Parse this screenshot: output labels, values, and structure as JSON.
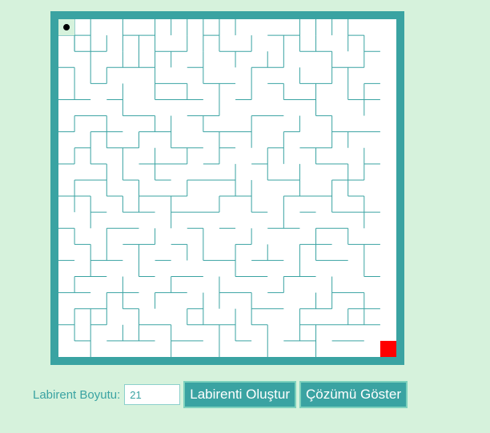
{
  "maze": {
    "size": 21,
    "colors": {
      "border": "#3aa3a2",
      "wall": "#3aa3a2",
      "background": "#ffffff",
      "page": "#d6f2dc",
      "goal": "#ff0000",
      "player": "#000000",
      "start_cell": "#d6f2dc"
    },
    "start": {
      "row": 0,
      "col": 0
    },
    "goal": {
      "row": 20,
      "col": 20
    },
    "walls": [
      [
        1,
        0,
        1,
        2
      ],
      [
        2,
        0,
        2,
        2
      ],
      [
        4,
        0,
        4,
        2
      ],
      [
        6,
        0,
        6,
        2
      ],
      [
        7,
        0,
        7,
        1
      ],
      [
        8,
        0,
        8,
        1
      ],
      [
        9,
        0,
        9,
        2
      ],
      [
        10,
        0,
        10,
        1
      ],
      [
        11,
        0,
        11,
        1
      ],
      [
        15,
        0,
        15,
        2
      ],
      [
        16,
        0,
        16,
        1
      ],
      [
        17,
        0,
        17,
        1
      ],
      [
        18,
        0,
        18,
        2
      ],
      [
        1,
        1,
        1,
        2
      ],
      [
        3,
        1,
        3,
        2
      ],
      [
        5,
        1,
        5,
        3
      ],
      [
        8,
        1,
        8,
        2
      ],
      [
        10,
        1,
        10,
        2
      ],
      [
        12,
        1,
        12,
        2
      ],
      [
        14,
        1,
        14,
        3
      ],
      [
        16,
        1,
        16,
        2
      ],
      [
        19,
        1,
        19,
        3
      ],
      [
        2,
        2,
        2,
        4
      ],
      [
        4,
        2,
        4,
        3
      ],
      [
        6,
        2,
        6,
        3
      ],
      [
        7,
        2,
        7,
        3
      ],
      [
        9,
        2,
        9,
        3
      ],
      [
        11,
        2,
        11,
        3
      ],
      [
        13,
        2,
        13,
        3
      ],
      [
        17,
        2,
        17,
        4
      ],
      [
        1,
        3,
        1,
        5
      ],
      [
        3,
        3,
        3,
        4
      ],
      [
        6,
        3,
        6,
        5
      ],
      [
        9,
        3,
        9,
        4
      ],
      [
        12,
        3,
        12,
        5
      ],
      [
        15,
        3,
        15,
        4
      ],
      [
        18,
        3,
        18,
        5
      ],
      [
        4,
        4,
        4,
        6
      ],
      [
        8,
        4,
        8,
        5
      ],
      [
        10,
        4,
        10,
        6
      ],
      [
        14,
        4,
        14,
        5
      ],
      [
        16,
        4,
        16,
        6
      ],
      [
        19,
        4,
        19,
        6
      ],
      [
        1,
        6,
        1,
        7
      ],
      [
        3,
        6,
        3,
        8
      ],
      [
        6,
        6,
        6,
        7
      ],
      [
        7,
        6,
        7,
        8
      ],
      [
        9,
        6,
        9,
        7
      ],
      [
        12,
        6,
        12,
        8
      ],
      [
        15,
        6,
        15,
        7
      ],
      [
        17,
        6,
        17,
        8
      ],
      [
        2,
        7,
        2,
        9
      ],
      [
        5,
        7,
        5,
        8
      ],
      [
        10,
        7,
        10,
        9
      ],
      [
        14,
        7,
        14,
        9
      ],
      [
        18,
        7,
        18,
        8
      ],
      [
        1,
        8,
        1,
        9
      ],
      [
        4,
        8,
        4,
        10
      ],
      [
        6,
        8,
        6,
        10
      ],
      [
        8,
        8,
        8,
        9
      ],
      [
        13,
        8,
        13,
        10
      ],
      [
        16,
        8,
        16,
        9
      ],
      [
        19,
        8,
        19,
        10
      ],
      [
        3,
        9,
        3,
        11
      ],
      [
        11,
        9,
        11,
        11
      ],
      [
        15,
        9,
        15,
        11
      ],
      [
        18,
        9,
        18,
        11
      ],
      [
        1,
        10,
        1,
        12
      ],
      [
        5,
        10,
        5,
        12
      ],
      [
        8,
        10,
        8,
        11
      ],
      [
        12,
        10,
        12,
        12
      ],
      [
        17,
        10,
        17,
        12
      ],
      [
        2,
        11,
        2,
        13
      ],
      [
        4,
        11,
        4,
        12
      ],
      [
        7,
        11,
        7,
        13
      ],
      [
        10,
        11,
        10,
        12
      ],
      [
        14,
        11,
        14,
        13
      ],
      [
        19,
        11,
        19,
        13
      ],
      [
        1,
        13,
        1,
        14
      ],
      [
        3,
        13,
        3,
        15
      ],
      [
        6,
        13,
        6,
        14
      ],
      [
        9,
        13,
        9,
        15
      ],
      [
        12,
        13,
        12,
        14
      ],
      [
        16,
        13,
        16,
        15
      ],
      [
        18,
        13,
        18,
        14
      ],
      [
        2,
        14,
        2,
        16
      ],
      [
        5,
        14,
        5,
        16
      ],
      [
        8,
        14,
        8,
        15
      ],
      [
        11,
        14,
        11,
        16
      ],
      [
        13,
        14,
        13,
        15
      ],
      [
        15,
        14,
        15,
        16
      ],
      [
        19,
        14,
        19,
        16
      ],
      [
        1,
        16,
        1,
        17
      ],
      [
        4,
        16,
        4,
        18
      ],
      [
        7,
        16,
        7,
        17
      ],
      [
        10,
        16,
        10,
        18
      ],
      [
        14,
        16,
        14,
        17
      ],
      [
        17,
        16,
        17,
        18
      ],
      [
        3,
        17,
        3,
        19
      ],
      [
        6,
        17,
        6,
        18
      ],
      [
        9,
        17,
        9,
        19
      ],
      [
        12,
        17,
        12,
        19
      ],
      [
        16,
        17,
        16,
        18
      ],
      [
        19,
        17,
        19,
        19
      ],
      [
        1,
        18,
        1,
        20
      ],
      [
        2,
        18,
        2,
        19
      ],
      [
        5,
        18,
        5,
        20
      ],
      [
        8,
        18,
        8,
        19
      ],
      [
        11,
        18,
        11,
        20
      ],
      [
        15,
        18,
        15,
        20
      ],
      [
        18,
        18,
        18,
        19
      ],
      [
        2,
        19,
        2,
        21
      ],
      [
        4,
        19,
        4,
        20
      ],
      [
        7,
        19,
        7,
        21
      ],
      [
        10,
        19,
        10,
        21
      ],
      [
        13,
        19,
        13,
        21
      ],
      [
        16,
        19,
        16,
        21
      ],
      [
        0,
        1,
        2,
        1
      ],
      [
        4,
        1,
        6,
        1
      ],
      [
        9,
        1,
        10,
        1
      ],
      [
        13,
        1,
        15,
        1
      ],
      [
        18,
        1,
        19,
        1
      ],
      [
        1,
        2,
        3,
        2
      ],
      [
        6,
        2,
        8,
        2
      ],
      [
        10,
        2,
        12,
        2
      ],
      [
        15,
        2,
        17,
        2
      ],
      [
        19,
        2,
        20,
        2
      ],
      [
        0,
        3,
        1,
        3
      ],
      [
        3,
        3,
        6,
        3
      ],
      [
        8,
        3,
        9,
        3
      ],
      [
        12,
        3,
        14,
        3
      ],
      [
        17,
        3,
        19,
        3
      ],
      [
        2,
        4,
        3,
        4
      ],
      [
        6,
        4,
        8,
        4
      ],
      [
        9,
        4,
        11,
        4
      ],
      [
        13,
        4,
        14,
        4
      ],
      [
        15,
        4,
        17,
        4
      ],
      [
        19,
        4,
        20,
        4
      ],
      [
        0,
        5,
        2,
        5
      ],
      [
        3,
        5,
        4,
        5
      ],
      [
        6,
        5,
        9,
        5
      ],
      [
        11,
        5,
        12,
        5
      ],
      [
        14,
        5,
        16,
        5
      ],
      [
        18,
        5,
        20,
        5
      ],
      [
        1,
        6,
        3,
        6
      ],
      [
        4,
        6,
        6,
        6
      ],
      [
        8,
        6,
        10,
        6
      ],
      [
        12,
        6,
        14,
        6
      ],
      [
        16,
        6,
        17,
        6
      ],
      [
        0,
        7,
        1,
        7
      ],
      [
        2,
        7,
        4,
        7
      ],
      [
        5,
        7,
        7,
        7
      ],
      [
        9,
        7,
        12,
        7
      ],
      [
        14,
        7,
        15,
        7
      ],
      [
        17,
        7,
        20,
        7
      ],
      [
        1,
        8,
        2,
        8
      ],
      [
        3,
        8,
        5,
        8
      ],
      [
        7,
        8,
        9,
        8
      ],
      [
        10,
        8,
        11,
        8
      ],
      [
        13,
        8,
        14,
        8
      ],
      [
        15,
        8,
        17,
        8
      ],
      [
        0,
        9,
        1,
        9
      ],
      [
        2,
        9,
        3,
        9
      ],
      [
        5,
        9,
        8,
        9
      ],
      [
        9,
        9,
        10,
        9
      ],
      [
        12,
        9,
        13,
        9
      ],
      [
        16,
        9,
        18,
        9
      ],
      [
        19,
        9,
        20,
        9
      ],
      [
        1,
        10,
        3,
        10
      ],
      [
        4,
        10,
        5,
        10
      ],
      [
        6,
        10,
        7,
        10
      ],
      [
        8,
        10,
        11,
        10
      ],
      [
        13,
        10,
        15,
        10
      ],
      [
        17,
        10,
        19,
        10
      ],
      [
        0,
        11,
        2,
        11
      ],
      [
        3,
        11,
        4,
        11
      ],
      [
        5,
        11,
        8,
        11
      ],
      [
        10,
        11,
        12,
        11
      ],
      [
        14,
        11,
        17,
        11
      ],
      [
        18,
        11,
        19,
        11
      ],
      [
        2,
        12,
        3,
        12
      ],
      [
        4,
        12,
        6,
        12
      ],
      [
        7,
        12,
        10,
        12
      ],
      [
        12,
        12,
        13,
        12
      ],
      [
        15,
        12,
        16,
        12
      ],
      [
        17,
        12,
        20,
        12
      ],
      [
        0,
        13,
        1,
        13
      ],
      [
        3,
        13,
        5,
        13
      ],
      [
        8,
        13,
        9,
        13
      ],
      [
        10,
        13,
        11,
        13
      ],
      [
        13,
        13,
        15,
        13
      ],
      [
        16,
        13,
        18,
        13
      ],
      [
        1,
        14,
        2,
        14
      ],
      [
        4,
        14,
        6,
        14
      ],
      [
        7,
        14,
        8,
        14
      ],
      [
        11,
        14,
        12,
        14
      ],
      [
        15,
        14,
        17,
        14
      ],
      [
        18,
        14,
        20,
        14
      ],
      [
        0,
        15,
        1,
        15
      ],
      [
        2,
        15,
        4,
        15
      ],
      [
        6,
        15,
        7,
        15
      ],
      [
        9,
        15,
        11,
        15
      ],
      [
        12,
        15,
        14,
        15
      ],
      [
        16,
        15,
        18,
        15
      ],
      [
        1,
        16,
        3,
        16
      ],
      [
        5,
        16,
        6,
        16
      ],
      [
        7,
        16,
        9,
        16
      ],
      [
        11,
        16,
        13,
        16
      ],
      [
        14,
        16,
        16,
        16
      ],
      [
        19,
        16,
        20,
        16
      ],
      [
        0,
        17,
        2,
        17
      ],
      [
        3,
        17,
        5,
        17
      ],
      [
        6,
        17,
        8,
        17
      ],
      [
        10,
        17,
        12,
        17
      ],
      [
        13,
        17,
        14,
        17
      ],
      [
        17,
        17,
        19,
        17
      ],
      [
        1,
        18,
        3,
        18
      ],
      [
        4,
        18,
        5,
        18
      ],
      [
        8,
        18,
        9,
        18
      ],
      [
        12,
        18,
        14,
        18
      ],
      [
        15,
        18,
        17,
        18
      ],
      [
        18,
        18,
        20,
        18
      ],
      [
        0,
        19,
        1,
        19
      ],
      [
        2,
        19,
        3,
        19
      ],
      [
        5,
        19,
        7,
        19
      ],
      [
        8,
        19,
        11,
        19
      ],
      [
        12,
        19,
        13,
        19
      ],
      [
        15,
        19,
        20,
        19
      ],
      [
        1,
        20,
        2,
        20
      ],
      [
        3,
        20,
        6,
        20
      ],
      [
        7,
        20,
        9,
        20
      ],
      [
        11,
        20,
        12,
        20
      ],
      [
        14,
        20,
        16,
        20
      ],
      [
        17,
        20,
        19,
        20
      ]
    ]
  },
  "controls": {
    "size_label": "Labirent Boyutu:",
    "size_value": "21",
    "generate_button": "Labirenti Oluştur",
    "solve_button": "Çözümü Göster"
  }
}
